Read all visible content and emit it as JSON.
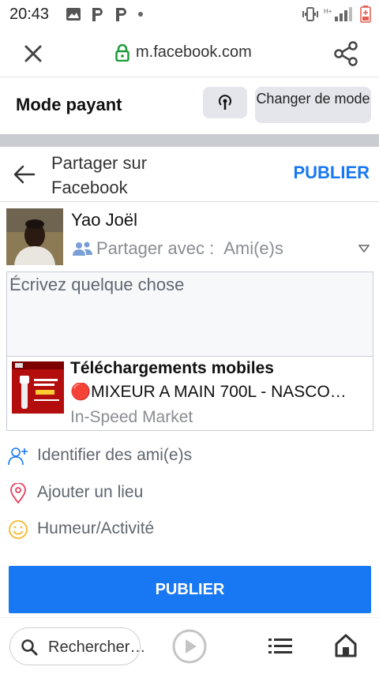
{
  "status": {
    "time": "20:43"
  },
  "browser": {
    "url": "m.facebook.com"
  },
  "mode": {
    "title": "Mode payant",
    "change_label": "Changer de mode"
  },
  "share": {
    "title": "Partager sur Facebook",
    "publish_top": "PUBLIER"
  },
  "user": {
    "name": "Yao Joël",
    "audience_prefix": "Partager avec :",
    "audience_value": "Ami(e)s"
  },
  "compose": {
    "placeholder": "Écrivez quelque chose"
  },
  "attachment": {
    "source": "Téléchargements mobiles",
    "description": "🔴MIXEUR A MAIN 700L - NASCO…",
    "publisher": "In-Speed Market"
  },
  "actions": [
    {
      "label": "Identifier des ami(e)s",
      "icon": "tag-friends-icon",
      "color": "#1877f2"
    },
    {
      "label": "Ajouter un lieu",
      "icon": "location-pin-icon",
      "color": "#e4405f"
    },
    {
      "label": "Humeur/Activité",
      "icon": "smiley-icon",
      "color": "#f7b928"
    }
  ],
  "publish_main": "PUBLIER",
  "bottom": {
    "search_label": "Rechercher…"
  },
  "colors": {
    "accent": "#1877f2",
    "secure": "#1d9a3a"
  }
}
